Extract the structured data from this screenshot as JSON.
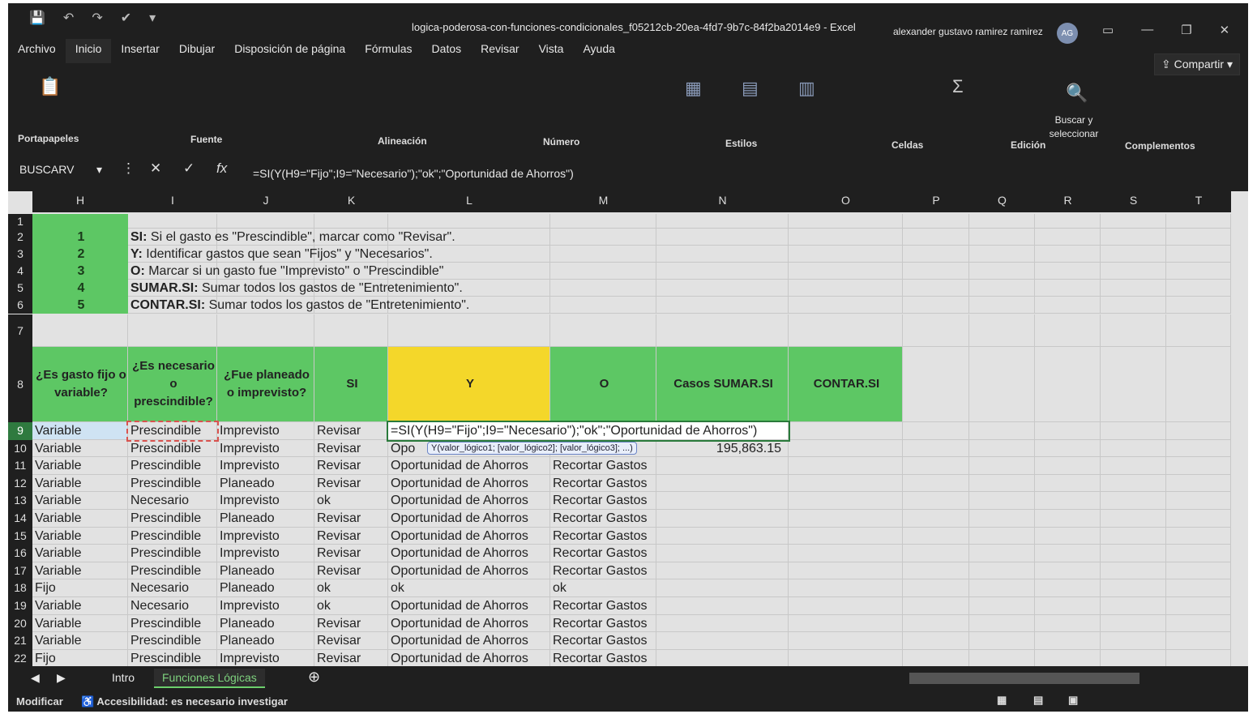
{
  "window": {
    "title": "logica-poderosa-con-funciones-condicionales_f05212cb-20ea-4fd7-9b7c-84f2ba2014e9  -  Excel",
    "user": "alexander gustavo ramirez ramirez",
    "avatar": "AG"
  },
  "menu": [
    "Archivo",
    "Inicio",
    "Insertar",
    "Dibujar",
    "Disposición de página",
    "Fórmulas",
    "Datos",
    "Revisar",
    "Vista",
    "Ayuda"
  ],
  "share_label": "Compartir",
  "ribbon_groups": [
    "Portapapeles",
    "Fuente",
    "Alineación",
    "Número",
    "Estilos",
    "Celdas",
    "Edición",
    "Complementos"
  ],
  "find_label": "Buscar y seleccionar",
  "namebox": "BUSCARV",
  "formula": "=SI(Y(H9=\"Fijo\";I9=\"Necesario\");\"ok\";\"Oportunidad de Ahorros\")",
  "columns": [
    "H",
    "I",
    "J",
    "K",
    "L",
    "M",
    "N",
    "O",
    "P",
    "Q",
    "R",
    "S",
    "T"
  ],
  "instructions": [
    {
      "n": "1",
      "bold": "SI:",
      "text": " Si el gasto es \"Prescindible\", marcar como \"Revisar\"."
    },
    {
      "n": "2",
      "bold": "Y:",
      "text": " Identificar gastos que sean \"Fijos\" y \"Necesarios\"."
    },
    {
      "n": "3",
      "bold": "O:",
      "text": " Marcar si un gasto fue \"Imprevisto\" o \"Prescindible\""
    },
    {
      "n": "4",
      "bold": "SUMAR.SI:",
      "text": " Sumar todos los gastos de \"Entretenimiento\"."
    },
    {
      "n": "5",
      "bold": "CONTAR.SI:",
      "text": " Sumar todos los gastos de \"Entretenimiento\"."
    }
  ],
  "headers": [
    "¿Es gasto fijo o variable?",
    "¿Es necesario o prescindible?",
    "¿Fue planeado o imprevisto?",
    "SI",
    "Y",
    "O",
    "Casos SUMAR.SI",
    "CONTAR.SI"
  ],
  "rows": [
    [
      "9",
      "Variable",
      "Prescindible",
      "Imprevisto",
      "Revisar",
      "=SI(Y(H9=\"Fijo\";I9=\"Necesario\");\"ok\";\"Oportunidad de Ahorros\")",
      ""
    ],
    [
      "10",
      "Variable",
      "Prescindible",
      "Imprevisto",
      "Revisar",
      "Opo",
      ""
    ],
    [
      "11",
      "Variable",
      "Prescindible",
      "Imprevisto",
      "Revisar",
      "Oportunidad de Ahorros",
      "Recortar Gastos"
    ],
    [
      "12",
      "Variable",
      "Prescindible",
      "Planeado",
      "Revisar",
      "Oportunidad de Ahorros",
      "Recortar Gastos"
    ],
    [
      "13",
      "Variable",
      "Necesario",
      "Imprevisto",
      "ok",
      "Oportunidad de Ahorros",
      "Recortar Gastos"
    ],
    [
      "14",
      "Variable",
      "Prescindible",
      "Planeado",
      "Revisar",
      "Oportunidad de Ahorros",
      "Recortar Gastos"
    ],
    [
      "15",
      "Variable",
      "Prescindible",
      "Imprevisto",
      "Revisar",
      "Oportunidad de Ahorros",
      "Recortar Gastos"
    ],
    [
      "16",
      "Variable",
      "Prescindible",
      "Imprevisto",
      "Revisar",
      "Oportunidad de Ahorros",
      "Recortar Gastos"
    ],
    [
      "17",
      "Variable",
      "Prescindible",
      "Planeado",
      "Revisar",
      "Oportunidad de Ahorros",
      "Recortar Gastos"
    ],
    [
      "18",
      "Fijo",
      "Necesario",
      "Planeado",
      "ok",
      "ok",
      "ok"
    ],
    [
      "19",
      "Variable",
      "Necesario",
      "Imprevisto",
      "ok",
      "Oportunidad de Ahorros",
      "Recortar Gastos"
    ],
    [
      "20",
      "Variable",
      "Prescindible",
      "Planeado",
      "Revisar",
      "Oportunidad de Ahorros",
      "Recortar Gastos"
    ],
    [
      "21",
      "Variable",
      "Prescindible",
      "Planeado",
      "Revisar",
      "Oportunidad de Ahorros",
      "Recortar Gastos"
    ],
    [
      "22",
      "Fijo",
      "Prescindible",
      "Imprevisto",
      "Revisar",
      "Oportunidad de Ahorros",
      "Recortar Gastos"
    ]
  ],
  "sumar_si_value": "195,863.15",
  "tooltip": "Y(valor_lógico1; [valor_lógico2]; [valor_lógico3]; ...)",
  "sheet_tabs": [
    "Intro",
    "Funciones Lógicas"
  ],
  "status": {
    "mode": "Modificar",
    "accessibility": "Accesibilidad: es necesario investigar"
  }
}
